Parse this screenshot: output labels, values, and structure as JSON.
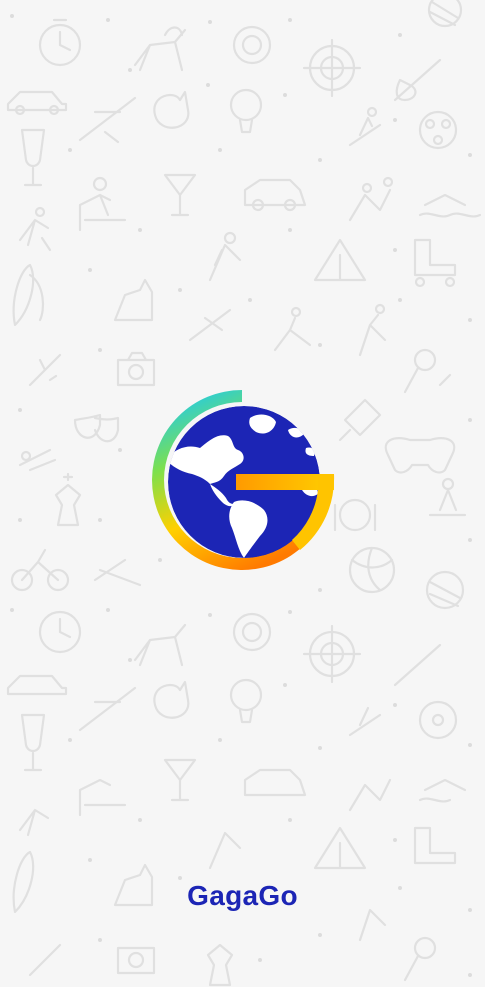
{
  "app": {
    "name": "GagaGo"
  },
  "logo": {
    "icon": "gagago-globe-logo-icon"
  },
  "background": {
    "pattern": "travel-hobby-doodle-pattern"
  },
  "colors": {
    "background": "#f6f6f6",
    "pattern_stroke": "#e0e0e0",
    "brand_blue": "#1c25b5",
    "globe_land": "#ffffff",
    "gradient": [
      "#14c7ff",
      "#7ee04c",
      "#ffd000",
      "#ff7a00"
    ]
  }
}
